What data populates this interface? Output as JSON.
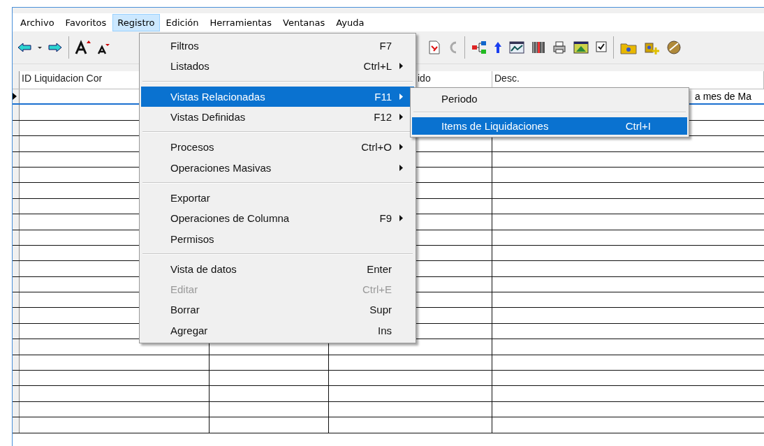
{
  "menubar": [
    {
      "label": "Archivo",
      "selected": false
    },
    {
      "label": "Favoritos",
      "selected": false
    },
    {
      "label": "Registro",
      "selected": true
    },
    {
      "label": "Edición",
      "selected": false
    },
    {
      "label": "Herramientas",
      "selected": false
    },
    {
      "label": "Ventanas",
      "selected": false
    },
    {
      "label": "Ayuda",
      "selected": false
    }
  ],
  "grid": {
    "columns": [
      {
        "heading": "ID Liquidacion Cor"
      },
      {},
      {
        "heading": "ido"
      },
      {
        "heading": "Desc."
      }
    ],
    "rows": [
      {
        "selected": true,
        "cells": [
          "",
          "",
          "",
          "a mes de Ma"
        ]
      },
      {
        "selected": false
      },
      {
        "selected": false
      },
      {
        "selected": false
      },
      {
        "selected": false
      },
      {
        "selected": false
      },
      {
        "selected": false
      },
      {
        "selected": false
      },
      {
        "selected": false
      },
      {
        "selected": false
      },
      {
        "selected": false
      },
      {
        "selected": false
      },
      {
        "selected": false
      },
      {
        "selected": false
      },
      {
        "selected": false
      },
      {
        "selected": false
      },
      {
        "selected": false
      },
      {
        "selected": false
      },
      {
        "selected": false
      },
      {
        "selected": false
      },
      {
        "selected": false
      },
      {
        "selected": false
      }
    ]
  },
  "menu": {
    "items": [
      {
        "kind": "item",
        "label": "Filtros",
        "shortcut": "F7",
        "submenu": false,
        "disabled": false,
        "selected": false
      },
      {
        "kind": "item",
        "label": "Listados",
        "shortcut": "Ctrl+L",
        "submenu": true,
        "disabled": false,
        "selected": false
      },
      {
        "kind": "separator"
      },
      {
        "kind": "item",
        "label": "Vistas Relacionadas",
        "shortcut": "F11",
        "submenu": true,
        "disabled": false,
        "selected": true
      },
      {
        "kind": "item",
        "label": "Vistas Definidas",
        "shortcut": "F12",
        "submenu": true,
        "disabled": false,
        "selected": false
      },
      {
        "kind": "separator"
      },
      {
        "kind": "item",
        "label": "Procesos",
        "shortcut": "Ctrl+O",
        "submenu": true,
        "disabled": false,
        "selected": false
      },
      {
        "kind": "item",
        "label": "Operaciones Masivas",
        "submenu": true,
        "disabled": false,
        "selected": false
      },
      {
        "kind": "separator"
      },
      {
        "kind": "item",
        "label": "Exportar",
        "submenu": false,
        "disabled": false,
        "selected": false
      },
      {
        "kind": "item",
        "label": "Operaciones de Columna",
        "shortcut": "F9",
        "submenu": true,
        "disabled": false,
        "selected": false
      },
      {
        "kind": "item",
        "label": "Permisos",
        "submenu": false,
        "disabled": false,
        "selected": false
      },
      {
        "kind": "separator"
      },
      {
        "kind": "item",
        "label": "Vista de datos",
        "shortcut": "Enter",
        "submenu": false,
        "disabled": false,
        "selected": false
      },
      {
        "kind": "item",
        "label": "Editar",
        "shortcut": "Ctrl+E",
        "submenu": false,
        "disabled": true,
        "selected": false
      },
      {
        "kind": "item",
        "label": "Borrar",
        "shortcut": "Supr",
        "submenu": false,
        "disabled": false,
        "selected": false
      },
      {
        "kind": "item",
        "label": "Agregar",
        "shortcut": "Ins",
        "submenu": false,
        "disabled": false,
        "selected": false
      }
    ]
  },
  "submenu": {
    "items": [
      {
        "kind": "item",
        "label": "Periodo",
        "submenu": false,
        "disabled": false,
        "selected": false
      },
      {
        "kind": "separator"
      },
      {
        "kind": "item",
        "label": "Items de Liquidaciones",
        "shortcut": "Ctrl+I",
        "submenu": false,
        "disabled": false,
        "selected": true
      }
    ]
  }
}
